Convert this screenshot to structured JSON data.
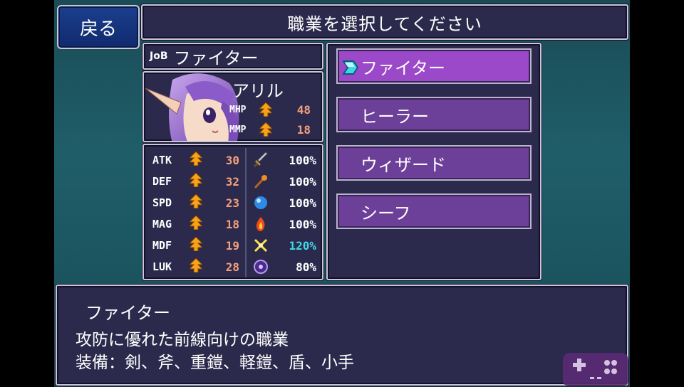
{
  "header": {
    "back_label": "戻る",
    "title": "職業を選択してください"
  },
  "current_job": {
    "tag": "JoB",
    "name": "ファイター"
  },
  "character": {
    "name": "アリル",
    "mhp_label": "MHP",
    "mhp_value": "48",
    "mmp_label": "MMP",
    "mmp_value": "18"
  },
  "stats": [
    {
      "label": "ATK",
      "value": "30",
      "res_icon": "sword-icon",
      "res_value": "100%",
      "res_color": "#ffffff"
    },
    {
      "label": "DEF",
      "value": "32",
      "res_icon": "staff-icon",
      "res_value": "100%",
      "res_color": "#ffffff"
    },
    {
      "label": "SPD",
      "value": "23",
      "res_icon": "water-gem-icon",
      "res_value": "100%",
      "res_color": "#ffffff"
    },
    {
      "label": "MAG",
      "value": "18",
      "res_icon": "fire-icon",
      "res_value": "100%",
      "res_color": "#ffffff"
    },
    {
      "label": "MDF",
      "value": "19",
      "res_icon": "lightning-icon",
      "res_value": "120%",
      "res_color": "#3fd7e6"
    },
    {
      "label": "LUK",
      "value": "28",
      "res_icon": "dark-orb-icon",
      "res_value": "80%",
      "res_color": "#ffffff"
    }
  ],
  "jobs": [
    {
      "label": "ファイター",
      "selected": true
    },
    {
      "label": "ヒーラー",
      "selected": false
    },
    {
      "label": "ウィザード",
      "selected": false
    },
    {
      "label": "シーフ",
      "selected": false
    }
  ],
  "description": {
    "title": "ファイター",
    "line1": "攻防に優れた前線向けの職業",
    "line2": "装備：剣、斧、重鎧、軽鎧、盾、小手"
  },
  "colors": {
    "panel": "#2c2a4c",
    "job_button": "#6c3f99",
    "job_button_selected": "#9b49c8",
    "stat_number": "#f4a07a",
    "boost_arrow": "#f6a21a"
  }
}
